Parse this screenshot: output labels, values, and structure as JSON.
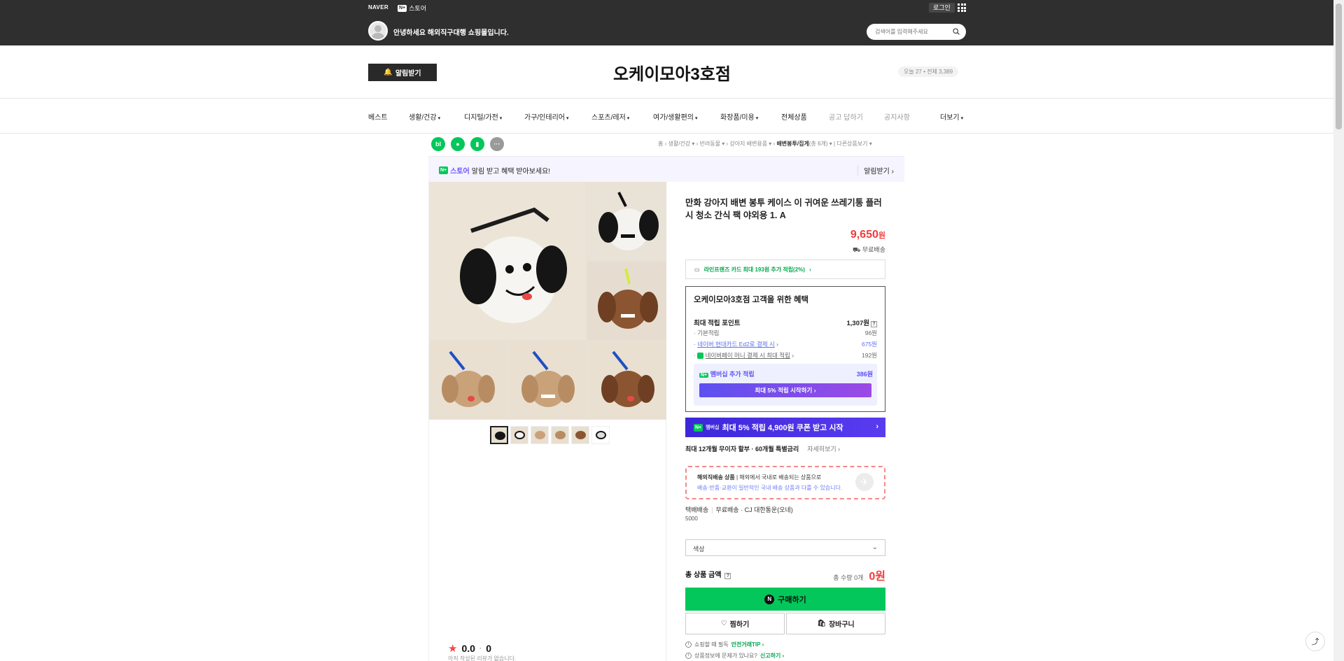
{
  "topbar": {
    "naver_logo": "NAVER",
    "store_badge": "N+",
    "store_label": "스토어",
    "login": "로그인",
    "greeting": "안녕하세요 해외직구대행 쇼핑몰입니다.",
    "search_placeholder": "검색어를 입력해주세요"
  },
  "header": {
    "alarm_button": "알림받기",
    "store_title": "오케이모아3호점",
    "visit_count": "오늘 27 • 전체 3,389"
  },
  "nav": {
    "items": [
      "베스트",
      "생활/건강",
      "디지털/가전",
      "가구/인테리어",
      "스포츠/레저",
      "여가/생활편의",
      "화장품/미용",
      "전체상품",
      "공고 답하기",
      "공지사항"
    ],
    "more": "더보기"
  },
  "share_icons": [
    "blog",
    "talk",
    "bookmark",
    "more"
  ],
  "breadcrumb": {
    "items": [
      "홈",
      "생활/건강",
      "반려동물",
      "강아지 배변용품",
      "배변봉투/집게"
    ],
    "count": "(총 6개)",
    "other": "다른상품보기"
  },
  "promo": {
    "badge": "N+",
    "store": "스토어",
    "text": "알림 받고 혜택 받아보세요!",
    "alarm": "알림받기"
  },
  "product": {
    "name": "만화 강아지 배변 봉투 케이스 이 귀여운 쓰레기통 플러시 청소 간식 팩 야외용 1. A",
    "price": "9,650",
    "won": "원",
    "shipping": "무료배송",
    "card_benefit": "라인프렌즈 카드 최대 193원 추가 적립(2%)"
  },
  "benefit": {
    "title": "오케이모아3호점 고객을 위한 혜택",
    "max_point_label": "최대 적립 포인트",
    "max_point": "1,307원",
    "rows": [
      {
        "label": "기본적립",
        "value": "96원"
      },
      {
        "label": "네이버 현대카드 Ed2로 결제 시",
        "value": "675원"
      },
      {
        "label": "네이버페이 머니 결제 시 최대 적립",
        "value": "192원"
      }
    ],
    "member_label": "멤버십 추가 적립",
    "member_value": "386원",
    "member_button": "최대 5% 적립 시작하기"
  },
  "membership_banner": {
    "badge": "N+",
    "badge_text": "멤버십",
    "text": "최대 5% 적립 4,900원 쿠폰 받고 시작"
  },
  "installment": {
    "text": "최대 12개월 무이자 할부 · 60개월 특별금리",
    "link": "자세히보기"
  },
  "overseas": {
    "title": "해외직배송 상품",
    "desc": "해외에서 국내로 배송되는 상품으로",
    "note": "배송·반품·교환이 일반적인 국내 배송 상품과 다를 수 있습니다."
  },
  "delivery": {
    "type": "택배배송",
    "fee_type": "무료배송",
    "carrier": "CJ 대한통운(오네)",
    "fee": "5000"
  },
  "option": {
    "placeholder": "색상"
  },
  "total": {
    "label": "총 상품 금액",
    "qty": "총 수량 0개",
    "amount": "0원"
  },
  "buttons": {
    "buy": "구매하기",
    "zzim": "찜하기",
    "cart": "장바구니"
  },
  "info": {
    "safe_prefix": "쇼핑할 때 필독",
    "safe_link": "안전거래TIP",
    "report_prefix": "상품정보에 문제가 있나요?",
    "report_link": "신고하기"
  },
  "review": {
    "score": "0.0",
    "count": "0",
    "empty": "아직 작성된 리뷰가 없습니다."
  },
  "colors": {
    "accent_green": "#03c75a",
    "price_red": "#f03c3c",
    "member_purple": "#5b50f0"
  }
}
